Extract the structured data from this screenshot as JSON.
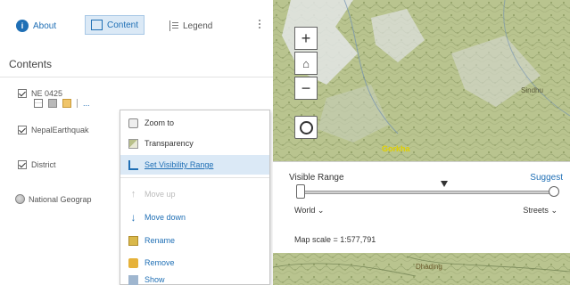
{
  "tabs": {
    "about": "About",
    "content": "Content",
    "legend": "Legend"
  },
  "contents_title": "Contents",
  "layers": [
    {
      "label": "NE 0425",
      "checked": true
    },
    {
      "label": "NepalEarthquak",
      "checked": true
    },
    {
      "label": "District",
      "checked": true
    },
    {
      "label": "National Geograp",
      "checked": false
    }
  ],
  "layer_tools": {
    "more_label": "..."
  },
  "context_menu": {
    "items": [
      {
        "label": "Zoom to",
        "icon": "zoom-icon"
      },
      {
        "label": "Transparency",
        "icon": "transparency-icon"
      },
      {
        "label": "Set Visibility Range",
        "icon": "visibility-range-icon"
      },
      {
        "label": "Move up",
        "icon": "arrow-up-icon"
      },
      {
        "label": "Move down",
        "icon": "arrow-down-icon"
      },
      {
        "label": "Rename",
        "icon": "rename-icon"
      },
      {
        "label": "Remove",
        "icon": "remove-icon"
      },
      {
        "label": "Show",
        "icon": "more-icon"
      }
    ]
  },
  "map": {
    "zoom_in": "+",
    "zoom_out": "−",
    "home": "⌂",
    "place_labels": [
      "Gorkha",
      "Dhading",
      "Sindhu"
    ]
  },
  "visible_range": {
    "title": "Visible Range",
    "suggest": "Suggest",
    "min_scale": "World",
    "max_scale": "Streets",
    "map_scale": "Map scale = 1:577,791"
  },
  "colors": {
    "accent": "#1f6fb5",
    "selected_tab_bg": "#dbe9f6",
    "map_base": "#b8c38e"
  }
}
